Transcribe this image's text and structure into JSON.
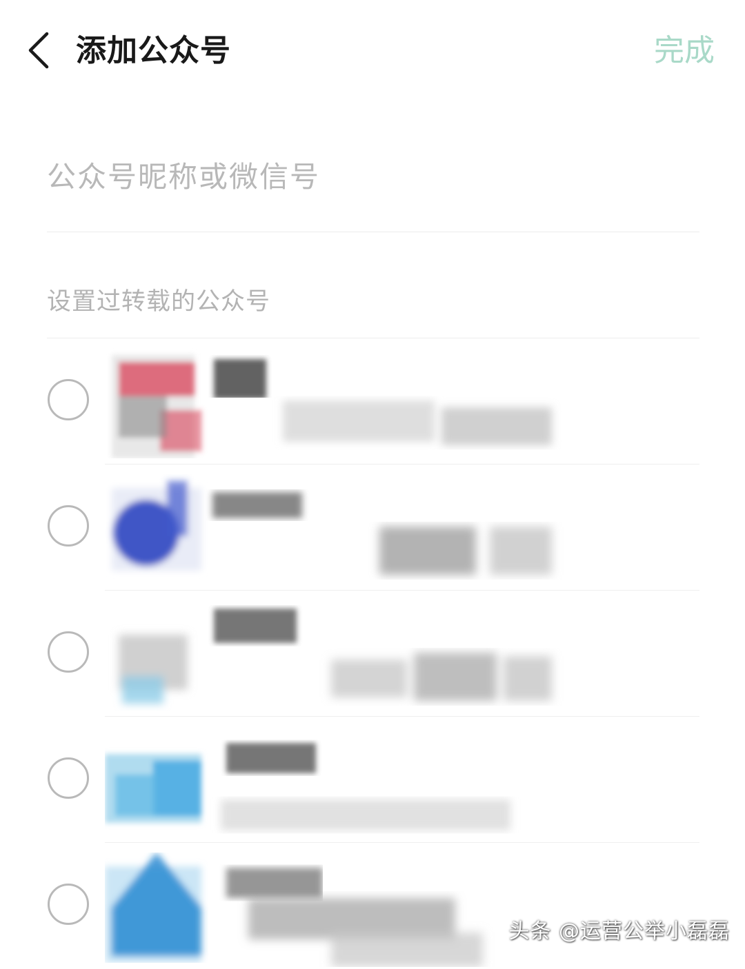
{
  "header": {
    "title": "添加公众号",
    "done_label": "完成"
  },
  "search": {
    "placeholder": "公众号昵称或微信号"
  },
  "section": {
    "title": "设置过转载的公众号"
  },
  "accounts": [
    {
      "selected": false,
      "avatar_color": "#d9435a",
      "redacted": true
    },
    {
      "selected": false,
      "avatar_color": "#2f47c0",
      "redacted": true
    },
    {
      "selected": false,
      "avatar_color": "#8fcde8",
      "redacted": true
    },
    {
      "selected": false,
      "avatar_color": "#3aa3e0",
      "redacted": true
    },
    {
      "selected": false,
      "avatar_color": "#1f84d0",
      "redacted": true
    }
  ],
  "colors": {
    "done": "#a9d9c8",
    "title": "#191919",
    "placeholder": "#b8b8b8",
    "radio_border": "#b9b9b9"
  },
  "icons": {
    "back": "chevron-left-icon",
    "radio": "radio-unchecked-icon"
  },
  "watermark": "头条 @运营公举小磊磊"
}
